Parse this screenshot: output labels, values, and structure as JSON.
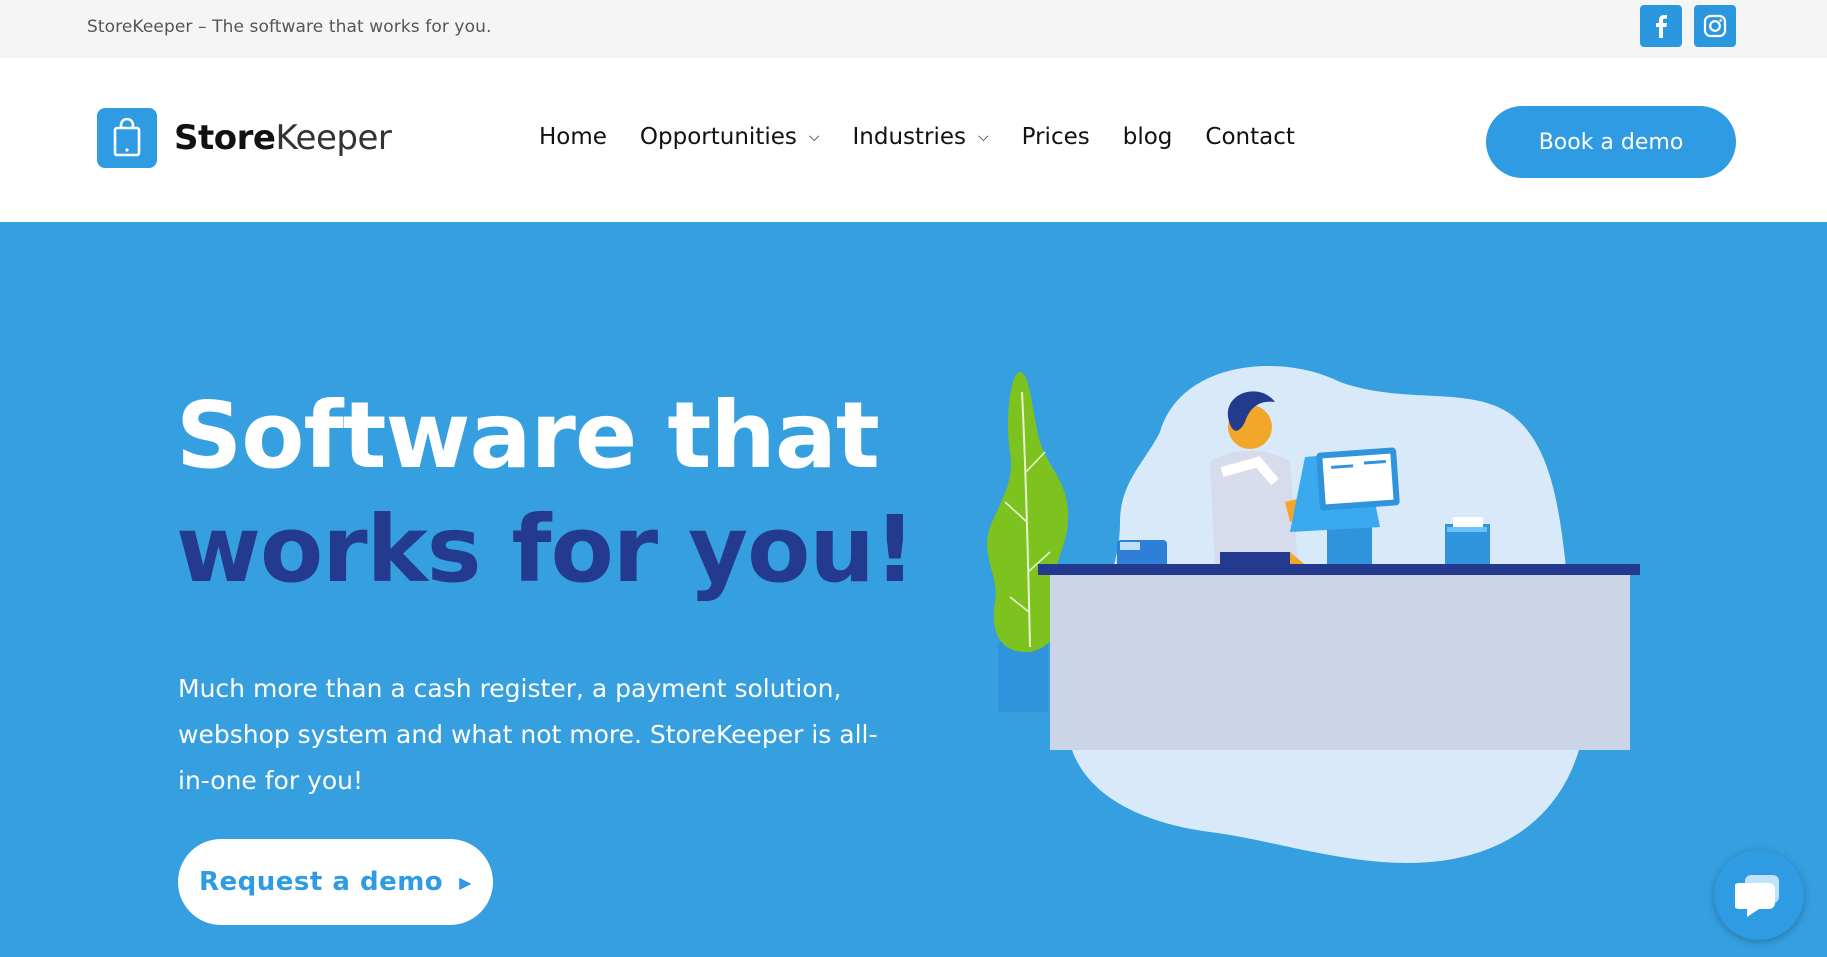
{
  "topbar": {
    "tagline": "StoreKeeper – The software that works for you.",
    "social": [
      {
        "icon": "facebook-icon"
      },
      {
        "icon": "instagram-icon"
      }
    ]
  },
  "header": {
    "logo": {
      "bold": "Store",
      "light": "Keeper"
    },
    "nav": [
      {
        "label": "Home",
        "dropdown": false
      },
      {
        "label": "Opportunities",
        "dropdown": true
      },
      {
        "label": "Industries",
        "dropdown": true
      },
      {
        "label": "Prices",
        "dropdown": false
      },
      {
        "label": "blog",
        "dropdown": false
      },
      {
        "label": "Contact",
        "dropdown": false
      }
    ],
    "cta": "Book a demo"
  },
  "hero": {
    "title_line1": "Software that",
    "title_line2": "works for you!",
    "description": "Much more than a cash register, a payment solution, webshop system and what not more. StoreKeeper is all-in-one for you!",
    "button": "Request a demo"
  },
  "colors": {
    "brand_blue": "#2e9be3",
    "hero_bg": "#359fe0",
    "dark_navy": "#233a8f",
    "topbar_bg": "#f5f5f5"
  }
}
